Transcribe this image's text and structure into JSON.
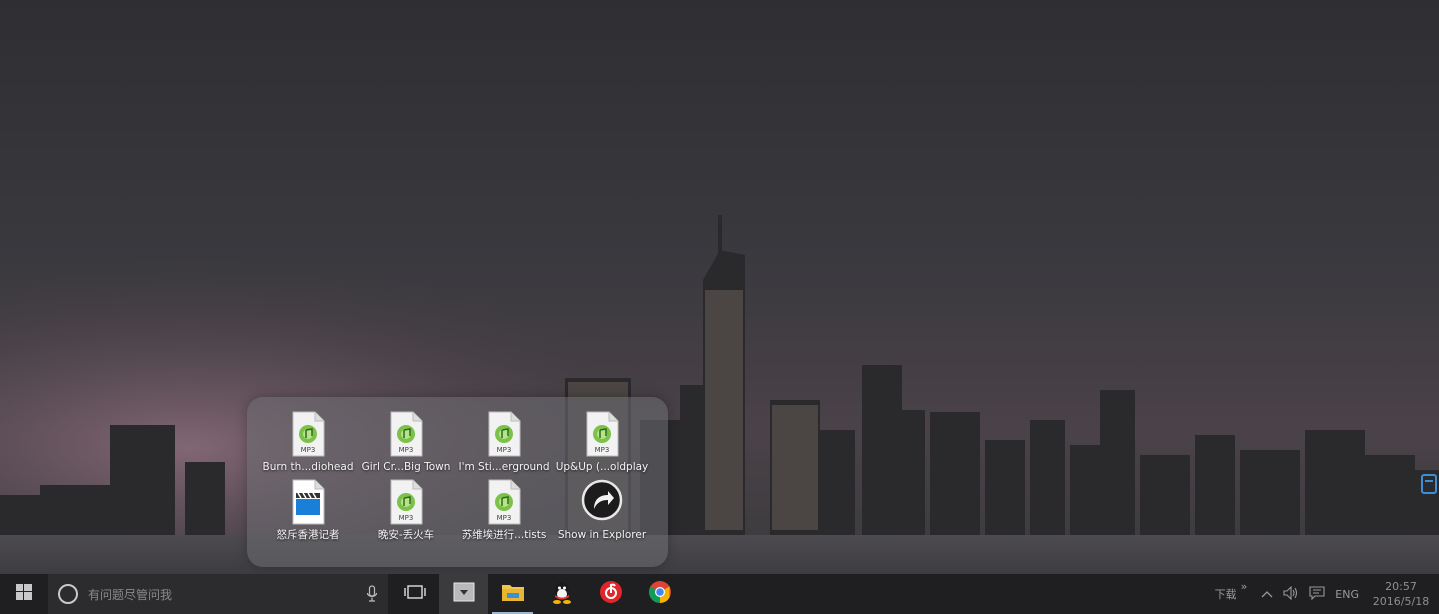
{
  "colors": {
    "taskbar": "#1f1f21",
    "search_bg": "#2c2c2e",
    "popup_bg": "rgba(110,110,114,0.55)",
    "accent_underline": "#9fb6cf"
  },
  "stack": {
    "items": [
      {
        "label": "Burn th...diohead",
        "icon": "mp3-file-icon",
        "badge": "MP3"
      },
      {
        "label": "Girl Cr...Big Town",
        "icon": "mp3-file-icon",
        "badge": "MP3"
      },
      {
        "label": "I'm Sti...erground",
        "icon": "mp3-file-icon",
        "badge": "MP3"
      },
      {
        "label": "Up&Up (...oldplay",
        "icon": "mp3-file-icon",
        "badge": "MP3"
      },
      {
        "label": "怒斥香港记者",
        "icon": "video-file-icon",
        "badge": ""
      },
      {
        "label": "晚安-丢火车",
        "icon": "mp3-file-icon",
        "badge": "MP3"
      },
      {
        "label": "苏维埃进行...tists",
        "icon": "mp3-file-icon",
        "badge": "MP3"
      },
      {
        "label": "Show in Explorer",
        "icon": "show-in-explorer-icon",
        "badge": ""
      }
    ]
  },
  "taskbar": {
    "search_placeholder": "有问题尽管问我",
    "apps": [
      {
        "name": "task-view-icon"
      },
      {
        "name": "stacks-icon"
      },
      {
        "name": "file-explorer-icon"
      },
      {
        "name": "qq-icon"
      },
      {
        "name": "netease-music-icon"
      },
      {
        "name": "chrome-icon"
      }
    ],
    "tray": {
      "toolbar_label": "下载",
      "toolbar_chevron": "»",
      "language": "ENG",
      "time": "20:57",
      "date": "2016/5/18"
    }
  }
}
